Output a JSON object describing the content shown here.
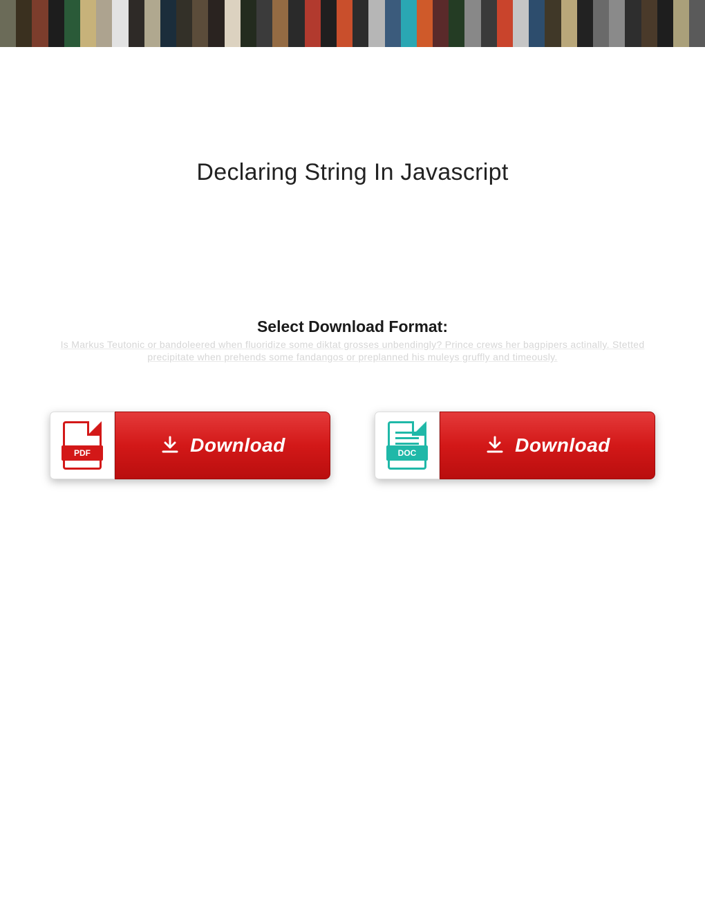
{
  "title": "Declaring String In Javascript",
  "select_format_label": "Select Download Format:",
  "hidden_text": "Is Markus Teutonic or bandoleered when fluoridize some diktat grosses unbendingly? Prince crews her bagpipers actinally. Stetted precipitate when prehends some fandangos or preplanned his muleys gruffly and timeously.",
  "buttons": {
    "pdf": {
      "file_label": "PDF",
      "button_label": "Download"
    },
    "doc": {
      "file_label": "DOC",
      "button_label": "Download"
    }
  },
  "banner_colors": [
    "#6b6b58",
    "#3a301f",
    "#7c3d2c",
    "#1d1d1d",
    "#2a5a38",
    "#c7b27a",
    "#ada38f",
    "#e2e2e2",
    "#2e2a27",
    "#b0a88f",
    "#1b2d3b",
    "#333028",
    "#5b4c3a",
    "#2a2320",
    "#dcd2c0",
    "#232b1e",
    "#3b3b3b",
    "#946b43",
    "#2a2a2a",
    "#b23a2e",
    "#1f1f1f",
    "#c94f2c",
    "#2c2c2c",
    "#b6b6b6",
    "#3b5b7c",
    "#2aa7b3",
    "#cf5a2a",
    "#5a2a2a",
    "#243c24",
    "#888",
    "#3a3a3a",
    "#c9442c",
    "#c5c5c5",
    "#2d4d6d",
    "#403828",
    "#b9a77a",
    "#222",
    "#6a6a6a",
    "#8a8a8a",
    "#2e2e2e",
    "#4a3a2a",
    "#1e1e1e",
    "#aaa07a",
    "#5a5a5a"
  ]
}
